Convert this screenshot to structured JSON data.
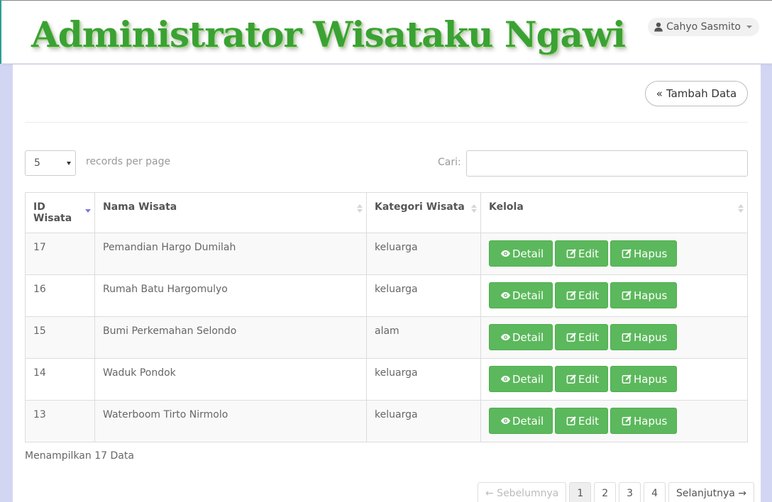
{
  "header": {
    "brand": "Administrator Wisataku Ngawi",
    "user_name": "Cahyo Sasmito"
  },
  "toolbar": {
    "add_label": "Tambah Data"
  },
  "controls": {
    "per_page_value": "5",
    "per_page_label": "records per page",
    "search_label": "Cari:",
    "search_value": ""
  },
  "table": {
    "columns": [
      "ID Wisata",
      "Nama Wisata",
      "Kategori Wisata",
      "Kelola"
    ],
    "rows": [
      {
        "id": "17",
        "nama": "Pemandian Hargo Dumilah",
        "kategori": "keluarga"
      },
      {
        "id": "16",
        "nama": "Rumah Batu Hargomulyo",
        "kategori": "keluarga"
      },
      {
        "id": "15",
        "nama": "Bumi Perkemahan Selondo",
        "kategori": "alam"
      },
      {
        "id": "14",
        "nama": "Waduk Pondok",
        "kategori": "keluarga"
      },
      {
        "id": "13",
        "nama": "Waterboom Tirto Nirmolo",
        "kategori": "keluarga"
      }
    ],
    "actions": {
      "detail": "Detail",
      "edit": "Edit",
      "hapus": "Hapus"
    }
  },
  "footer": {
    "info": "Menampilkan 17 Data"
  },
  "pagination": {
    "prev": "← Sebelumnya",
    "pages": [
      "1",
      "2",
      "3",
      "4"
    ],
    "active_page": "1",
    "next": "Selanjutnya →"
  },
  "colors": {
    "brand": "#3aa233",
    "action_button": "#5cb85c"
  },
  "icons": {
    "user": "user-icon",
    "add": "double-chevron-left-icon",
    "detail": "eye-icon",
    "edit": "edit-icon",
    "hapus": "edit-icon",
    "sort_active": "sort-desc-icon",
    "sort": "sort-icon"
  }
}
